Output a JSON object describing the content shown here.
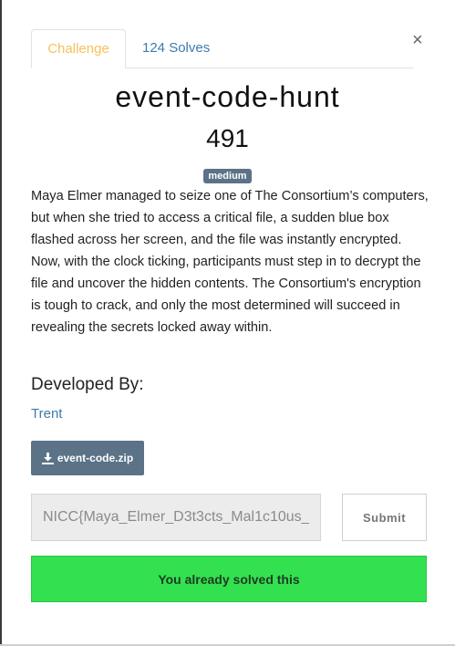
{
  "tabs": {
    "challenge": "Challenge",
    "solves": "124 Solves"
  },
  "close_glyph": "×",
  "challenge": {
    "name": "event-code-hunt",
    "points": "491",
    "difficulty": "medium",
    "description": "Maya Elmer managed to seize one of The Consortium’s computers, but when she tried to access a critical file, a sudden blue box flashed across her screen, and the file was instantly encrypted. Now, with the clock ticking, participants must step in to decrypt the file and uncover the hidden contents. The Consortium's encryption is tough to crack, and only the most determined will succeed in revealing the secrets locked away within.",
    "developed_by_label": "Developed By:",
    "developer": "Trent",
    "file_label": "event-code.zip"
  },
  "flag_input": {
    "value": "NICC{Maya_Elmer_D3t3cts_Mal1c10us_"
  },
  "submit_label": "Submit",
  "solved_message": "You already solved this",
  "icons": {
    "close": "close-icon",
    "download": "download-icon"
  },
  "colors": {
    "accent_tab": "#f5c15d",
    "link": "#3d7bae",
    "badge": "#5b7287",
    "success": "#33e150"
  }
}
